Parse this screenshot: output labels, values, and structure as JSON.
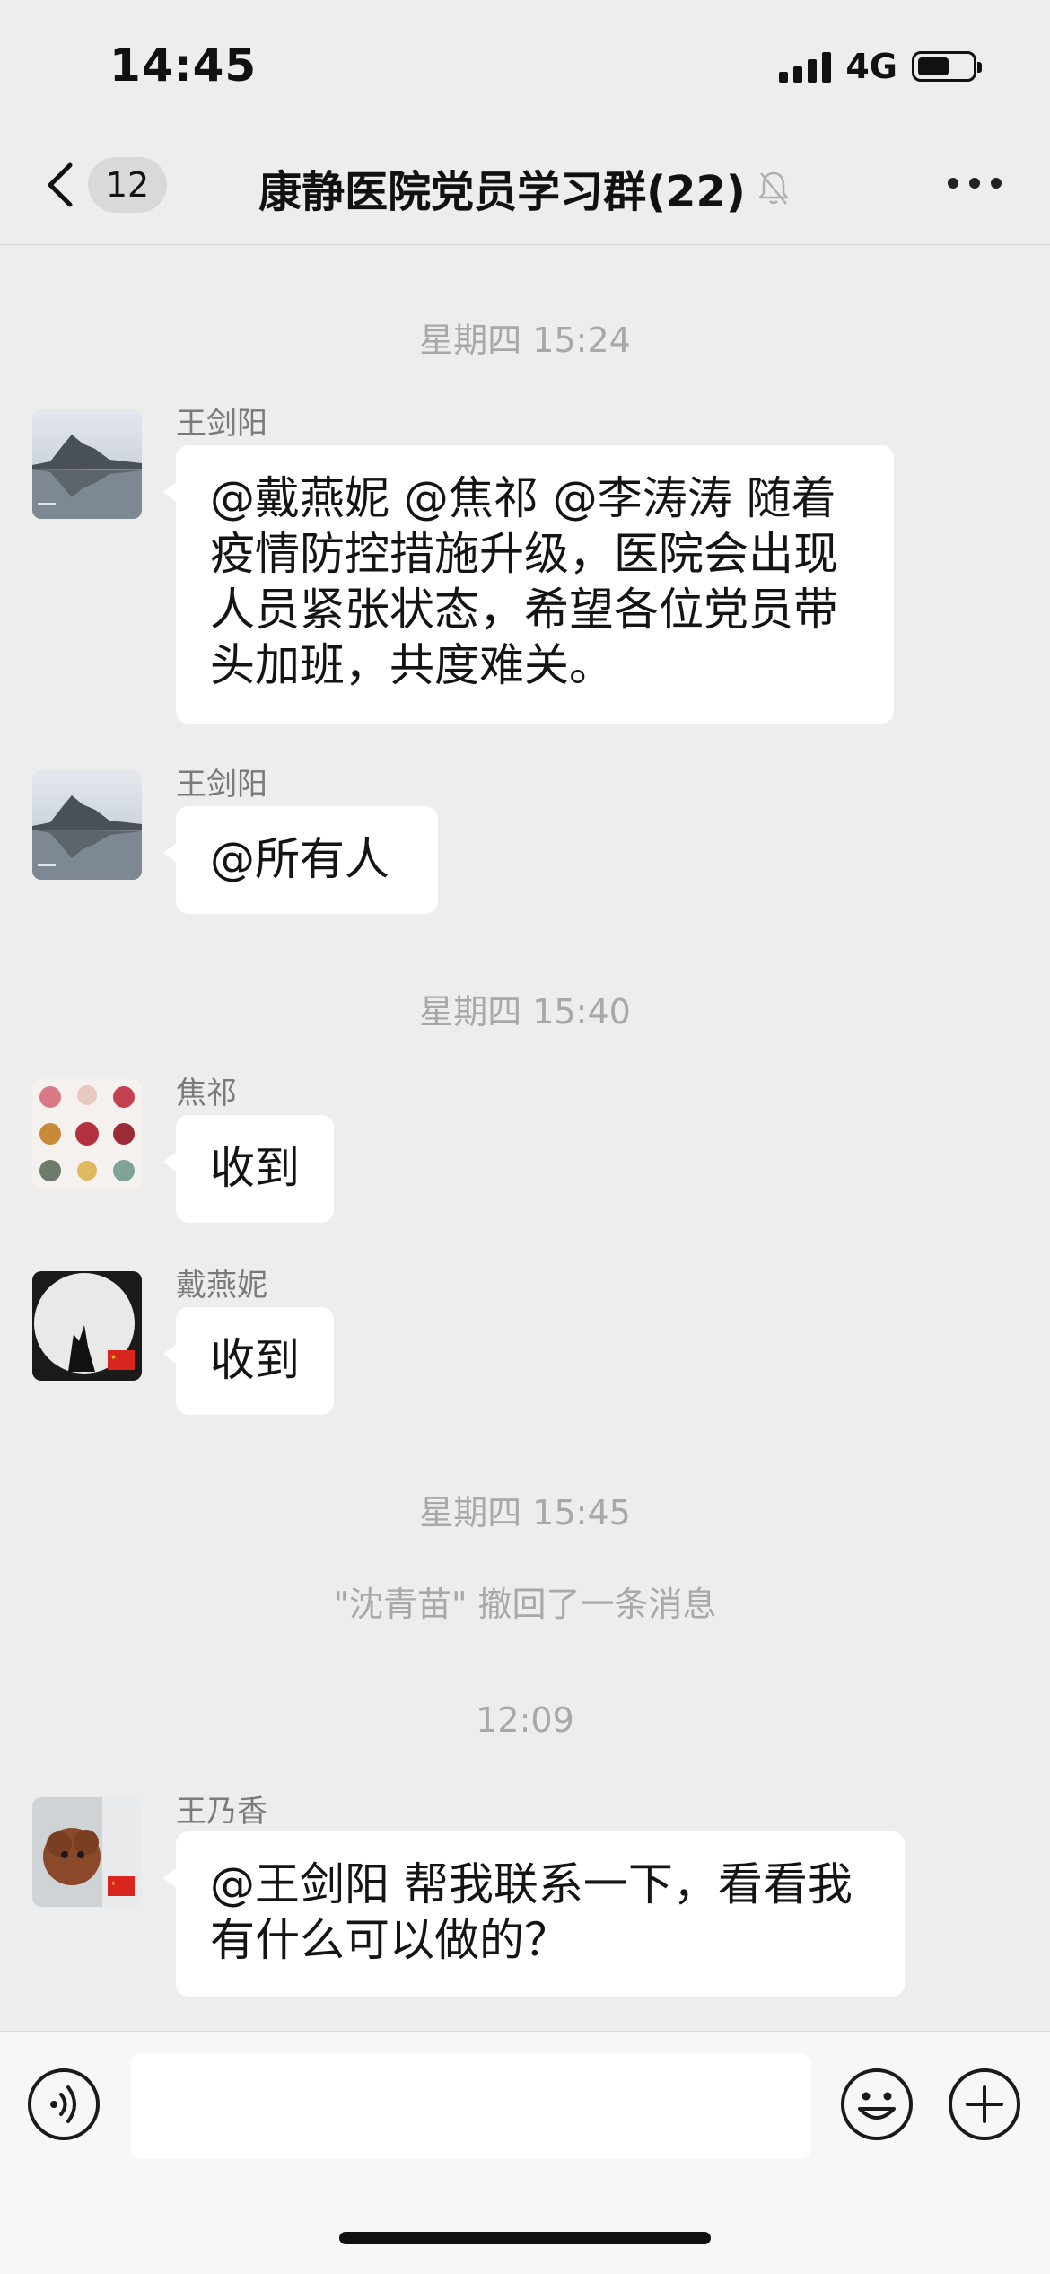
{
  "status_bar": {
    "time": "14:45",
    "network": "4G"
  },
  "nav": {
    "unread_count": "12",
    "title": "康静医院党员学习群(22)"
  },
  "messages": [
    {
      "type": "timestamp",
      "text": "星期四 15:24"
    },
    {
      "type": "message",
      "sender": "王剑阳",
      "lines": [
        "@戴燕妮 @焦祁 @李涛涛 随着",
        "疫情防控措施升级，医院会出现",
        "人员紧张状态，希望各位党员带",
        "头加班，共度难关。"
      ]
    },
    {
      "type": "message",
      "sender": "王剑阳",
      "lines": [
        "@所有人"
      ]
    },
    {
      "type": "timestamp",
      "text": "星期四 15:40"
    },
    {
      "type": "message",
      "sender": "焦祁",
      "lines": [
        "收到"
      ]
    },
    {
      "type": "message",
      "sender": "戴燕妮",
      "lines": [
        "收到"
      ]
    },
    {
      "type": "timestamp",
      "text": "星期四 15:45"
    },
    {
      "type": "system",
      "text": "\"沈青苗\" 撤回了一条消息"
    },
    {
      "type": "timestamp",
      "text": "12:09"
    },
    {
      "type": "message",
      "sender": "王乃香",
      "lines": [
        "@王剑阳 帮我联系一下，看看我",
        "有什么可以做的？"
      ]
    }
  ],
  "input": {
    "value": ""
  },
  "colors": {
    "background": "#ededed",
    "bubble": "#ffffff",
    "timestamp_text": "#a8a8a8",
    "sender_text": "#7a7a7a"
  },
  "icons": [
    "back-chevron-icon",
    "mute-bell-icon",
    "more-icon",
    "voice-icon",
    "emoji-icon",
    "plus-icon"
  ]
}
